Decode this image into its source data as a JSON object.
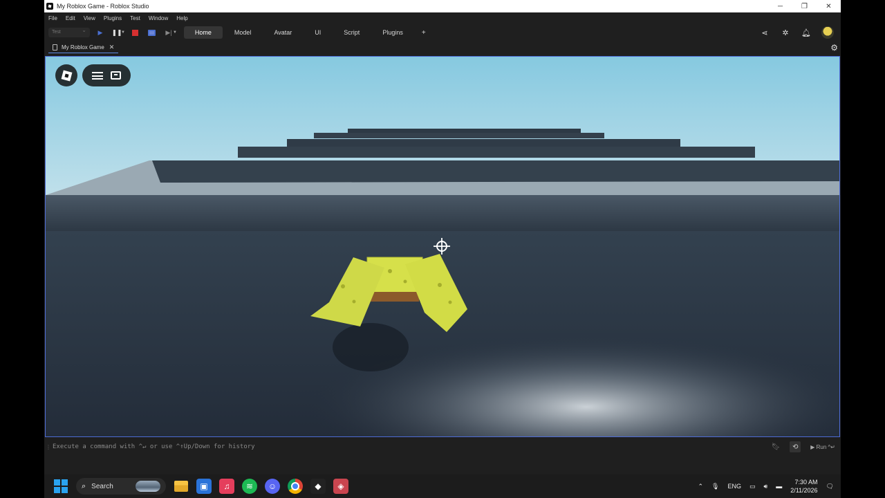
{
  "window": {
    "title": "My Roblox Game - Roblox Studio",
    "controls": {
      "minimize": "─",
      "restore": "❐",
      "close": "✕"
    }
  },
  "menubar": [
    "File",
    "Edit",
    "View",
    "Plugins",
    "Test",
    "Window",
    "Help"
  ],
  "toolbar": {
    "test_select": "Test",
    "tabs": [
      "Home",
      "Model",
      "Avatar",
      "UI",
      "Script",
      "Plugins",
      "+"
    ],
    "active_tab": "Home"
  },
  "document_tab": {
    "label": "My Roblox Game",
    "close": "✕"
  },
  "command_bar": {
    "placeholder": "Execute a command with ^↵ or use ^↑Up/Down for history",
    "run_label": "Run ^↵"
  },
  "taskbar": {
    "search_label": "Search",
    "tray": {
      "language": "ENG",
      "time": "7:30 AM",
      "date": "2/11/2026"
    }
  },
  "colors": {
    "accent": "#4d6bd6",
    "stop_red": "#d63030",
    "sky": "#8ecde3",
    "sponge": "#d6e04a"
  }
}
